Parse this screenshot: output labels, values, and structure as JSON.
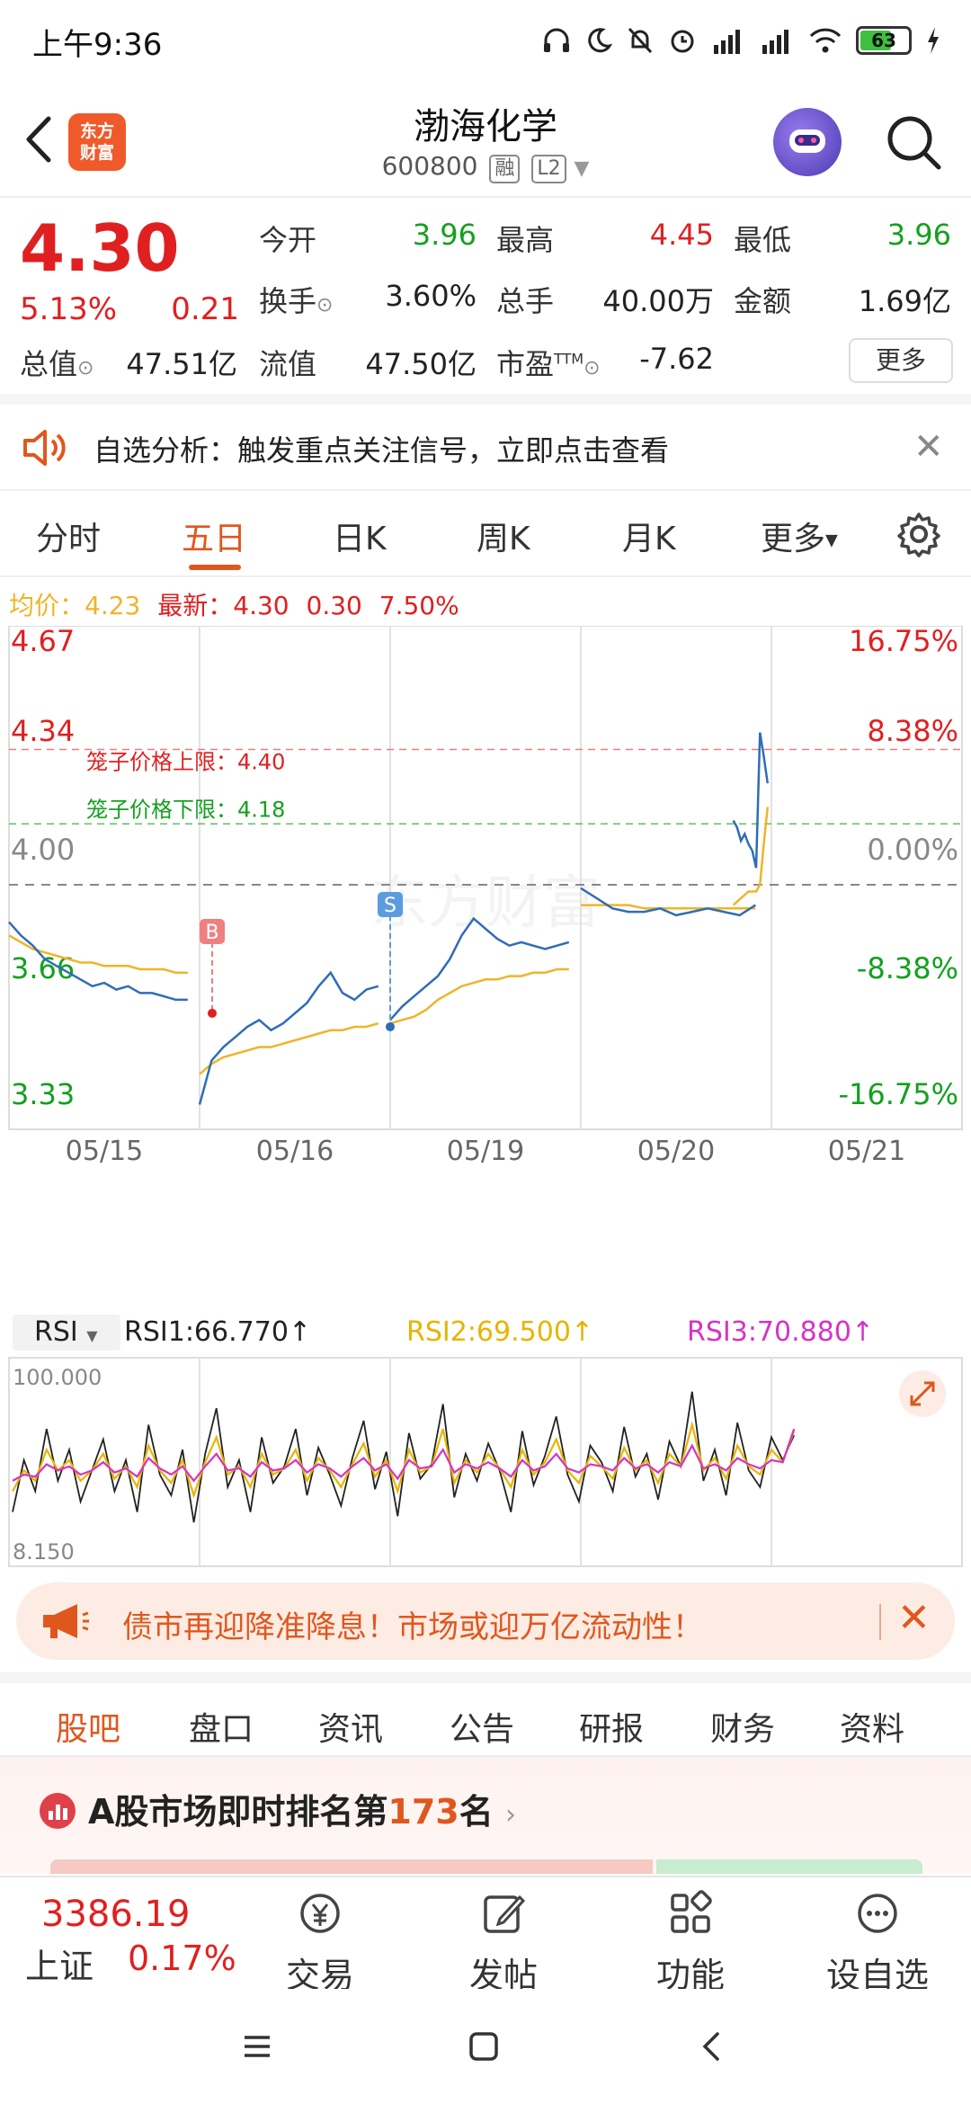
{
  "status_bar": {
    "time": "上午9:36",
    "battery": "63"
  },
  "header": {
    "title": "渤海化学",
    "code": "600800",
    "tag1": "融",
    "tag2": "L2",
    "logo_line1": "东方",
    "logo_line2": "财富"
  },
  "quote": {
    "price": "4.30",
    "pct": "5.13%",
    "change": "0.21",
    "open_label": "今开",
    "open": "3.96",
    "high_label": "最高",
    "high": "4.45",
    "low_label": "最低",
    "low": "3.96",
    "turnover_label": "换手",
    "turnover": "3.60%",
    "volume_label": "总手",
    "volume": "40.00万",
    "amount_label": "金额",
    "amount": "1.69亿",
    "mktcap_label": "总值",
    "mktcap": "47.51亿",
    "float_label": "流值",
    "float": "47.50亿",
    "pe_label": "市盈",
    "pe_sup": "TTM",
    "pe": "-7.62",
    "more": "更多"
  },
  "notice": {
    "text": "自选分析：触发重点关注信号，立即点击查看"
  },
  "tabs": [
    "分时",
    "五日",
    "日K",
    "周K",
    "月K",
    "更多"
  ],
  "legend": {
    "avg_label": "均价：",
    "avg": "4.23",
    "latest_label": "最新：",
    "latest": "4.30",
    "chg": "0.30",
    "pct": "7.50%"
  },
  "chart_data": [
    {
      "type": "line",
      "title": "",
      "x_labels": [
        "05/15",
        "05/16",
        "05/19",
        "05/20",
        "05/21"
      ],
      "y_left_labels": [
        "4.67",
        "4.34",
        "4.00",
        "3.66",
        "3.33"
      ],
      "y_right_labels": [
        "16.75%",
        "8.38%",
        "0.00%",
        "-8.38%",
        "-16.75%"
      ],
      "ylim": [
        3.33,
        4.67
      ],
      "annotations": [
        {
          "text": "笼子价格上限：4.40",
          "value": 4.4
        },
        {
          "text": "笼子价格下限：4.18",
          "value": 4.18
        }
      ],
      "markers": [
        {
          "label": "B",
          "value": 3.62
        },
        {
          "label": "S",
          "value": 3.58
        }
      ],
      "series": [
        {
          "values": [
            3.89,
            3.85,
            3.82,
            3.78,
            3.76,
            3.74,
            3.72,
            3.7,
            3.71,
            3.69,
            3.7,
            3.68,
            3.68,
            3.67,
            3.66,
            3.66,
            3.35,
            3.48,
            3.52,
            3.55,
            3.58,
            3.6,
            3.57,
            3.59,
            3.62,
            3.65,
            3.7,
            3.74,
            3.68,
            3.66,
            3.69,
            3.7,
            3.6,
            3.64,
            3.67,
            3.7,
            3.73,
            3.78,
            3.85,
            3.9,
            3.87,
            3.84,
            3.82,
            3.83,
            3.82,
            3.81,
            3.82,
            3.83,
            3.99,
            3.96,
            3.93,
            3.92,
            3.92,
            3.93,
            3.91,
            3.92,
            3.93,
            3.92,
            3.91,
            3.94,
            4.19,
            4.17,
            4.13,
            4.15,
            4.12,
            4.1,
            4.05,
            4.45,
            4.38,
            4.3
          ]
        },
        {
          "values": [
            3.85,
            3.83,
            3.81,
            3.8,
            3.79,
            3.78,
            3.77,
            3.77,
            3.76,
            3.76,
            3.76,
            3.75,
            3.75,
            3.75,
            3.74,
            3.74,
            3.44,
            3.47,
            3.49,
            3.5,
            3.51,
            3.52,
            3.52,
            3.53,
            3.54,
            3.55,
            3.56,
            3.57,
            3.57,
            3.58,
            3.58,
            3.59,
            3.59,
            3.6,
            3.61,
            3.63,
            3.66,
            3.68,
            3.7,
            3.71,
            3.72,
            3.72,
            3.73,
            3.73,
            3.74,
            3.74,
            3.75,
            3.75,
            3.94,
            3.94,
            3.94,
            3.94,
            3.93,
            3.93,
            3.93,
            3.93,
            3.93,
            3.93,
            3.93,
            3.93,
            3.94,
            3.95,
            3.96,
            3.97,
            3.98,
            3.98,
            3.98,
            4.0,
            4.12,
            4.23
          ]
        }
      ]
    },
    {
      "type": "line",
      "title": "",
      "y_top_label": "100.000",
      "y_bottom_label": "8.150",
      "ylim": [
        8.15,
        100
      ],
      "series": [
        {
          "name": "RSI1:66.770",
          "values": [
            30,
            55,
            40,
            70,
            45,
            60,
            35,
            50,
            65,
            40,
            55,
            30,
            72,
            48,
            38,
            60,
            25,
            58,
            80,
            42,
            55,
            30,
            66,
            44,
            52,
            70,
            38,
            61,
            48,
            33,
            56,
            74,
            41,
            59,
            28,
            68,
            46,
            53,
            82,
            37,
            58,
            45,
            63,
            50,
            30,
            69,
            43,
            57,
            76,
            48,
            35,
            62,
            54,
            40,
            71,
            47,
            58,
            36,
            64,
            52,
            88,
            45,
            60,
            38,
            73,
            50,
            42,
            66,
            55,
            67
          ]
        },
        {
          "name": "RSI2:69.500",
          "values": [
            40,
            50,
            45,
            60,
            50,
            55,
            45,
            50,
            58,
            46,
            52,
            42,
            62,
            50,
            44,
            55,
            38,
            54,
            66,
            48,
            52,
            42,
            58,
            48,
            51,
            60,
            45,
            56,
            50,
            42,
            53,
            63,
            47,
            55,
            40,
            60,
            49,
            52,
            70,
            44,
            55,
            49,
            58,
            51,
            42,
            60,
            48,
            54,
            65,
            50,
            44,
            57,
            52,
            46,
            61,
            50,
            55,
            44,
            58,
            52,
            72,
            50,
            56,
            46,
            62,
            52,
            48,
            60,
            54,
            69
          ]
        },
        {
          "name": "RSI3:70.880",
          "values": [
            45,
            48,
            47,
            53,
            50,
            52,
            48,
            50,
            54,
            49,
            51,
            47,
            56,
            51,
            48,
            52,
            45,
            52,
            58,
            50,
            51,
            47,
            54,
            50,
            51,
            55,
            49,
            53,
            51,
            47,
            52,
            56,
            50,
            53,
            46,
            55,
            51,
            52,
            60,
            49,
            53,
            51,
            54,
            51,
            47,
            55,
            50,
            52,
            58,
            51,
            49,
            53,
            52,
            50,
            56,
            51,
            53,
            49,
            54,
            52,
            62,
            51,
            53,
            50,
            56,
            53,
            51,
            55,
            54,
            70
          ]
        }
      ]
    }
  ],
  "rsi": {
    "selector": "RSI",
    "rsi1": "RSI1:66.770",
    "rsi2": "RSI2:69.500",
    "rsi3": "RSI3:70.880",
    "arrow": "↑"
  },
  "banner": {
    "text": "债市再迎降准降息！市场或迎万亿流动性！"
  },
  "bottom_tabs": [
    "股吧",
    "盘口",
    "资讯",
    "公告",
    "研报",
    "财务",
    "资料"
  ],
  "ranking": {
    "prefix": "A股市场即时排名第",
    "rank": "173",
    "suffix": "名"
  },
  "bottom_nav": {
    "index_value": "3386.19",
    "index_name": "上证",
    "index_pct": "0.17%",
    "items": [
      "交易",
      "发帖",
      "功能",
      "设自选"
    ]
  },
  "watermark": "东方财富",
  "colors": {
    "up": "#e02020",
    "down": "#14a01e",
    "accent": "#e0571e",
    "price_line": "#2f6db5",
    "avg_line": "#f0b429",
    "rsi3": "#d633c4"
  }
}
